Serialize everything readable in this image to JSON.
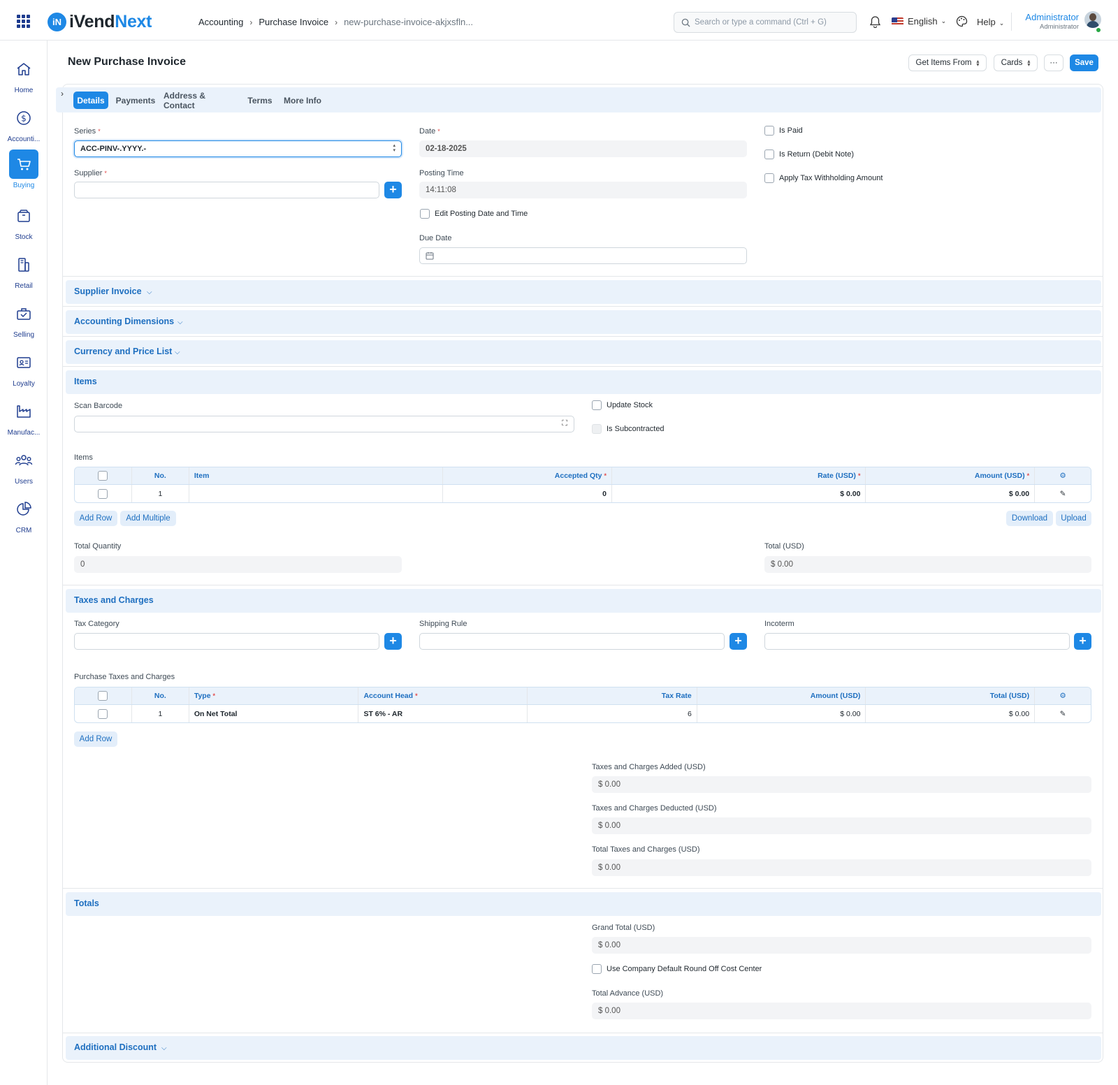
{
  "app": {
    "brand_part1": "iVend",
    "brand_part2": "Next",
    "logo_letter": "iN"
  },
  "breadcrumb": [
    "Accounting",
    "Purchase Invoice",
    "new-purchase-invoice-akjxsfln..."
  ],
  "search": {
    "placeholder": "Search or type a command (Ctrl + G)"
  },
  "header": {
    "language": "English",
    "help": "Help",
    "user_name": "Administrator",
    "user_role": "Administrator"
  },
  "sidebar": [
    {
      "label": "Home",
      "icon": "home-icon"
    },
    {
      "label": "Accounti...",
      "icon": "dollar-circle-icon"
    },
    {
      "label": "Buying",
      "icon": "cart-icon",
      "active": true
    },
    {
      "label": "Stock",
      "icon": "box-icon"
    },
    {
      "label": "Retail",
      "icon": "pos-icon"
    },
    {
      "label": "Selling",
      "icon": "shopping-bag-icon"
    },
    {
      "label": "Loyalty",
      "icon": "id-card-icon"
    },
    {
      "label": "Manufac...",
      "icon": "factory-icon"
    },
    {
      "label": "Users",
      "icon": "users-icon"
    },
    {
      "label": "CRM",
      "icon": "pie-chart-icon"
    }
  ],
  "page": {
    "title": "New Purchase Invoice",
    "actions": {
      "get_items": "Get Items From",
      "cards": "Cards",
      "more": "···",
      "save": "Save"
    }
  },
  "tabs": [
    "Details",
    "Payments",
    "Address & Contact",
    "Terms",
    "More Info"
  ],
  "details": {
    "series_label": "Series",
    "series_value": "ACC-PINV-.YYYY.-",
    "supplier_label": "Supplier",
    "supplier_value": "",
    "date_label": "Date",
    "date_value": "02-18-2025",
    "posting_time_label": "Posting Time",
    "posting_time_value": "14:11:08",
    "edit_posting_label": "Edit Posting Date and Time",
    "due_date_label": "Due Date",
    "is_paid_label": "Is Paid",
    "is_return_label": "Is Return (Debit Note)",
    "apply_tax_label": "Apply Tax Withholding Amount"
  },
  "sections": {
    "supplier_invoice": "Supplier Invoice",
    "accounting_dimensions": "Accounting Dimensions",
    "currency_price": "Currency and Price List",
    "items": "Items",
    "taxes": "Taxes and Charges",
    "totals": "Totals",
    "additional_discount": "Additional Discount"
  },
  "items": {
    "scan_barcode_label": "Scan Barcode",
    "update_stock_label": "Update Stock",
    "is_subcontracted_label": "Is Subcontracted",
    "table_label": "Items",
    "columns": [
      "No.",
      "Item",
      "Accepted Qty",
      "Rate (USD)",
      "Amount (USD)"
    ],
    "rows": [
      {
        "no": "1",
        "item": "",
        "qty": "0",
        "rate": "$ 0.00",
        "amount": "$ 0.00"
      }
    ],
    "add_row": "Add Row",
    "add_multiple": "Add Multiple",
    "download": "Download",
    "upload": "Upload",
    "total_qty_label": "Total Quantity",
    "total_qty_value": "0",
    "total_label": "Total (USD)",
    "total_value": "$ 0.00"
  },
  "taxes": {
    "tax_category_label": "Tax Category",
    "shipping_rule_label": "Shipping Rule",
    "incoterm_label": "Incoterm",
    "table_label": "Purchase Taxes and Charges",
    "columns": [
      "No.",
      "Type",
      "Account Head",
      "Tax Rate",
      "Amount (USD)",
      "Total (USD)"
    ],
    "rows": [
      {
        "no": "1",
        "type": "On Net Total",
        "account_head": "ST 6% - AR",
        "tax_rate": "6",
        "amount": "$ 0.00",
        "total": "$ 0.00"
      }
    ],
    "add_row": "Add Row",
    "added_label": "Taxes and Charges Added (USD)",
    "added_value": "$ 0.00",
    "deducted_label": "Taxes and Charges Deducted (USD)",
    "deducted_value": "$ 0.00",
    "total_label": "Total Taxes and Charges (USD)",
    "total_value": "$ 0.00"
  },
  "totals": {
    "grand_total_label": "Grand Total (USD)",
    "grand_total_value": "$ 0.00",
    "round_off_label": "Use Company Default Round Off Cost Center",
    "total_advance_label": "Total Advance (USD)",
    "total_advance_value": "$ 0.00"
  },
  "colors": {
    "accent": "#1e88e5",
    "section_bg": "#eaf2fb",
    "required": "#e24c4c"
  }
}
